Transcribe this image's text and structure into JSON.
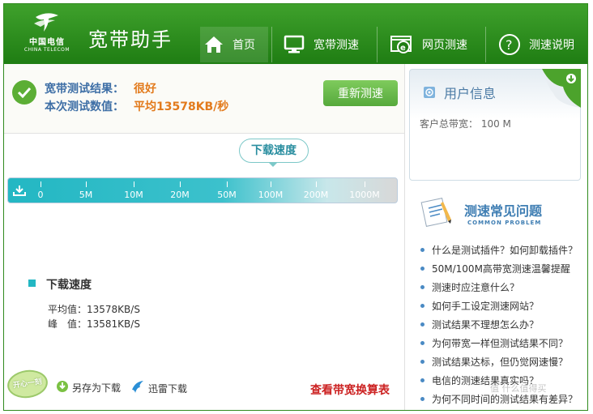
{
  "header": {
    "logo": {
      "cn": "中国电信",
      "en": "CHINA TELECOM"
    },
    "app_title": "宽带助手",
    "nav": [
      {
        "label": "首页",
        "icon": "home-icon"
      },
      {
        "label": "宽带测速",
        "icon": "monitor-icon"
      },
      {
        "label": "网页测速",
        "icon": "browser-icon"
      },
      {
        "label": "测速说明",
        "icon": "question-icon"
      }
    ]
  },
  "result": {
    "label1": "宽带测试结果：",
    "value1": "很好",
    "label2": "本次测试数值：",
    "value2": "平均13578KB/秒",
    "retest_label": "重新测速"
  },
  "scale": {
    "bubble_label": "下载速度",
    "ticks": [
      "0",
      "5M",
      "10M",
      "20M",
      "50M",
      "100M",
      "200M",
      "1000M"
    ]
  },
  "stats": {
    "title": "下载速度",
    "avg": "平均值：13578KB/S",
    "peak": "峰　值：13581KB/S"
  },
  "footer": {
    "badge": "开心一刻",
    "save_label": "另存为下载",
    "thunder_label": "迅雷下载",
    "calc_label": "查看带宽换算表"
  },
  "user_info": {
    "title": "用户信息",
    "bandwidth": "客户总带宽：  100 M"
  },
  "faq": {
    "title": "测速常见问题",
    "subtitle": "COMMON PROBLEM",
    "items": [
      "什么是测试插件？如何卸载插件？",
      "50M/100M高带宽测速温馨提醒",
      "测速时应注意什么？",
      "如何手工设定测速网站？",
      "测试结果不理想怎么办？",
      "为何带宽一样但测试结果不同？",
      "测试结果达标，但仍觉网速慢？",
      "电信的测速结果真实吗？",
      "为何不同时间的测试结果有差异？"
    ]
  },
  "watermark": "值 什么值得买",
  "colors": {
    "brand_green": "#2f8a1d",
    "accent_orange": "#e27a1c",
    "label_blue": "#3e6fa6",
    "scale_teal": "#23b7c3",
    "link_red": "#cc2222"
  }
}
